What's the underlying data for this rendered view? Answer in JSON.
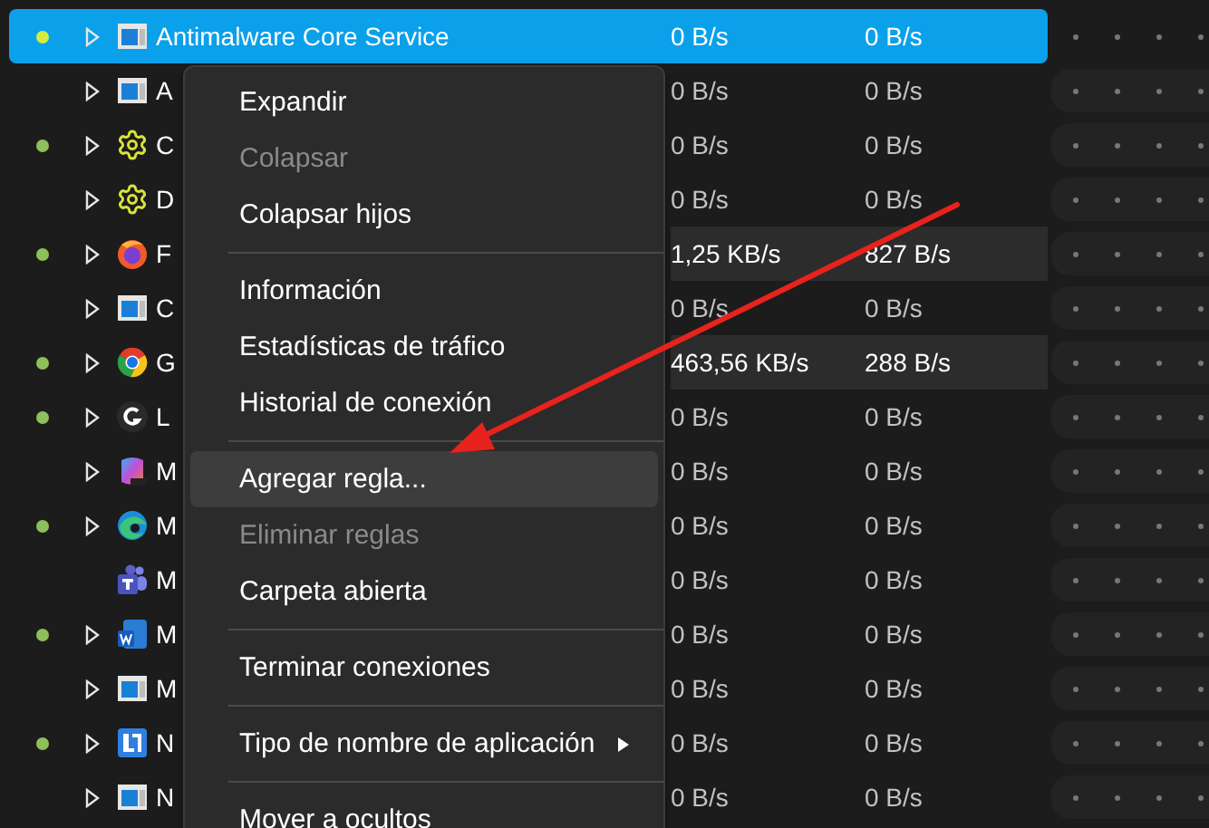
{
  "rows": [
    {
      "name": "Antimalware Core Service",
      "kind": "window",
      "active": true,
      "selected": true,
      "expandable": true,
      "highlighted": false,
      "download": "0 B/s",
      "upload": "0 B/s"
    },
    {
      "name": "A",
      "kind": "window",
      "active": false,
      "selected": false,
      "expandable": true,
      "highlighted": false,
      "download": "0 B/s",
      "upload": "0 B/s"
    },
    {
      "name": "C",
      "kind": "gear",
      "active": true,
      "selected": false,
      "expandable": true,
      "highlighted": false,
      "download": "0 B/s",
      "upload": "0 B/s"
    },
    {
      "name": "D",
      "kind": "gear",
      "active": false,
      "selected": false,
      "expandable": true,
      "highlighted": false,
      "download": "0 B/s",
      "upload": "0 B/s"
    },
    {
      "name": "F",
      "kind": "fox",
      "active": true,
      "selected": false,
      "expandable": true,
      "highlighted": true,
      "download": "1,25 KB/s",
      "upload": "827 B/s"
    },
    {
      "name": "C",
      "kind": "window",
      "active": false,
      "selected": false,
      "expandable": true,
      "highlighted": false,
      "download": "0 B/s",
      "upload": "0 B/s"
    },
    {
      "name": "G",
      "kind": "wheel",
      "active": true,
      "selected": false,
      "expandable": true,
      "highlighted": true,
      "download": "463,56 KB/s",
      "upload": "288 B/s"
    },
    {
      "name": "L",
      "kind": "disc",
      "active": true,
      "selected": false,
      "expandable": true,
      "highlighted": false,
      "download": "0 B/s",
      "upload": "0 B/s"
    },
    {
      "name": "M",
      "kind": "suite",
      "active": false,
      "selected": false,
      "expandable": true,
      "highlighted": false,
      "download": "0 B/s",
      "upload": "0 B/s"
    },
    {
      "name": "M",
      "kind": "wave",
      "active": true,
      "selected": false,
      "expandable": true,
      "highlighted": false,
      "download": "0 B/s",
      "upload": "0 B/s"
    },
    {
      "name": "M",
      "kind": "people",
      "active": false,
      "selected": false,
      "expandable": false,
      "highlighted": false,
      "download": "0 B/s",
      "upload": "0 B/s"
    },
    {
      "name": "M",
      "kind": "document",
      "active": true,
      "selected": false,
      "expandable": true,
      "highlighted": false,
      "download": "0 B/s",
      "upload": "0 B/s"
    },
    {
      "name": "M",
      "kind": "window",
      "active": false,
      "selected": false,
      "expandable": true,
      "highlighted": false,
      "download": "0 B/s",
      "upload": "0 B/s"
    },
    {
      "name": "N",
      "kind": "tile",
      "active": true,
      "selected": false,
      "expandable": true,
      "highlighted": false,
      "download": "0 B/s",
      "upload": "0 B/s"
    },
    {
      "name": "N",
      "kind": "window",
      "active": false,
      "selected": false,
      "expandable": true,
      "highlighted": false,
      "download": "0 B/s",
      "upload": "0 B/s"
    }
  ],
  "context_menu": {
    "items": [
      {
        "kind": "item",
        "label": "Expandir",
        "disabled": false,
        "hovered": false
      },
      {
        "kind": "item",
        "label": "Colapsar",
        "disabled": true,
        "hovered": false
      },
      {
        "kind": "item",
        "label": "Colapsar hijos",
        "disabled": false,
        "hovered": false
      },
      {
        "kind": "separator"
      },
      {
        "kind": "item",
        "label": "Información",
        "disabled": false,
        "hovered": false
      },
      {
        "kind": "item",
        "label": "Estadísticas de tráfico",
        "disabled": false,
        "hovered": false
      },
      {
        "kind": "item",
        "label": "Historial de conexión",
        "disabled": false,
        "hovered": false
      },
      {
        "kind": "separator"
      },
      {
        "kind": "item",
        "label": "Agregar regla...",
        "disabled": false,
        "hovered": true
      },
      {
        "kind": "item",
        "label": "Eliminar reglas",
        "disabled": true,
        "hovered": false
      },
      {
        "kind": "item",
        "label": "Carpeta abierta",
        "disabled": false,
        "hovered": false
      },
      {
        "kind": "separator"
      },
      {
        "kind": "item",
        "label": "Terminar conexiones",
        "disabled": false,
        "hovered": false
      },
      {
        "kind": "separator"
      },
      {
        "kind": "submenu",
        "label": "Tipo de nombre de aplicación",
        "disabled": false,
        "hovered": false
      },
      {
        "kind": "separator"
      },
      {
        "kind": "item",
        "label": "Mover a ocultos",
        "disabled": false,
        "hovered": false
      }
    ]
  }
}
